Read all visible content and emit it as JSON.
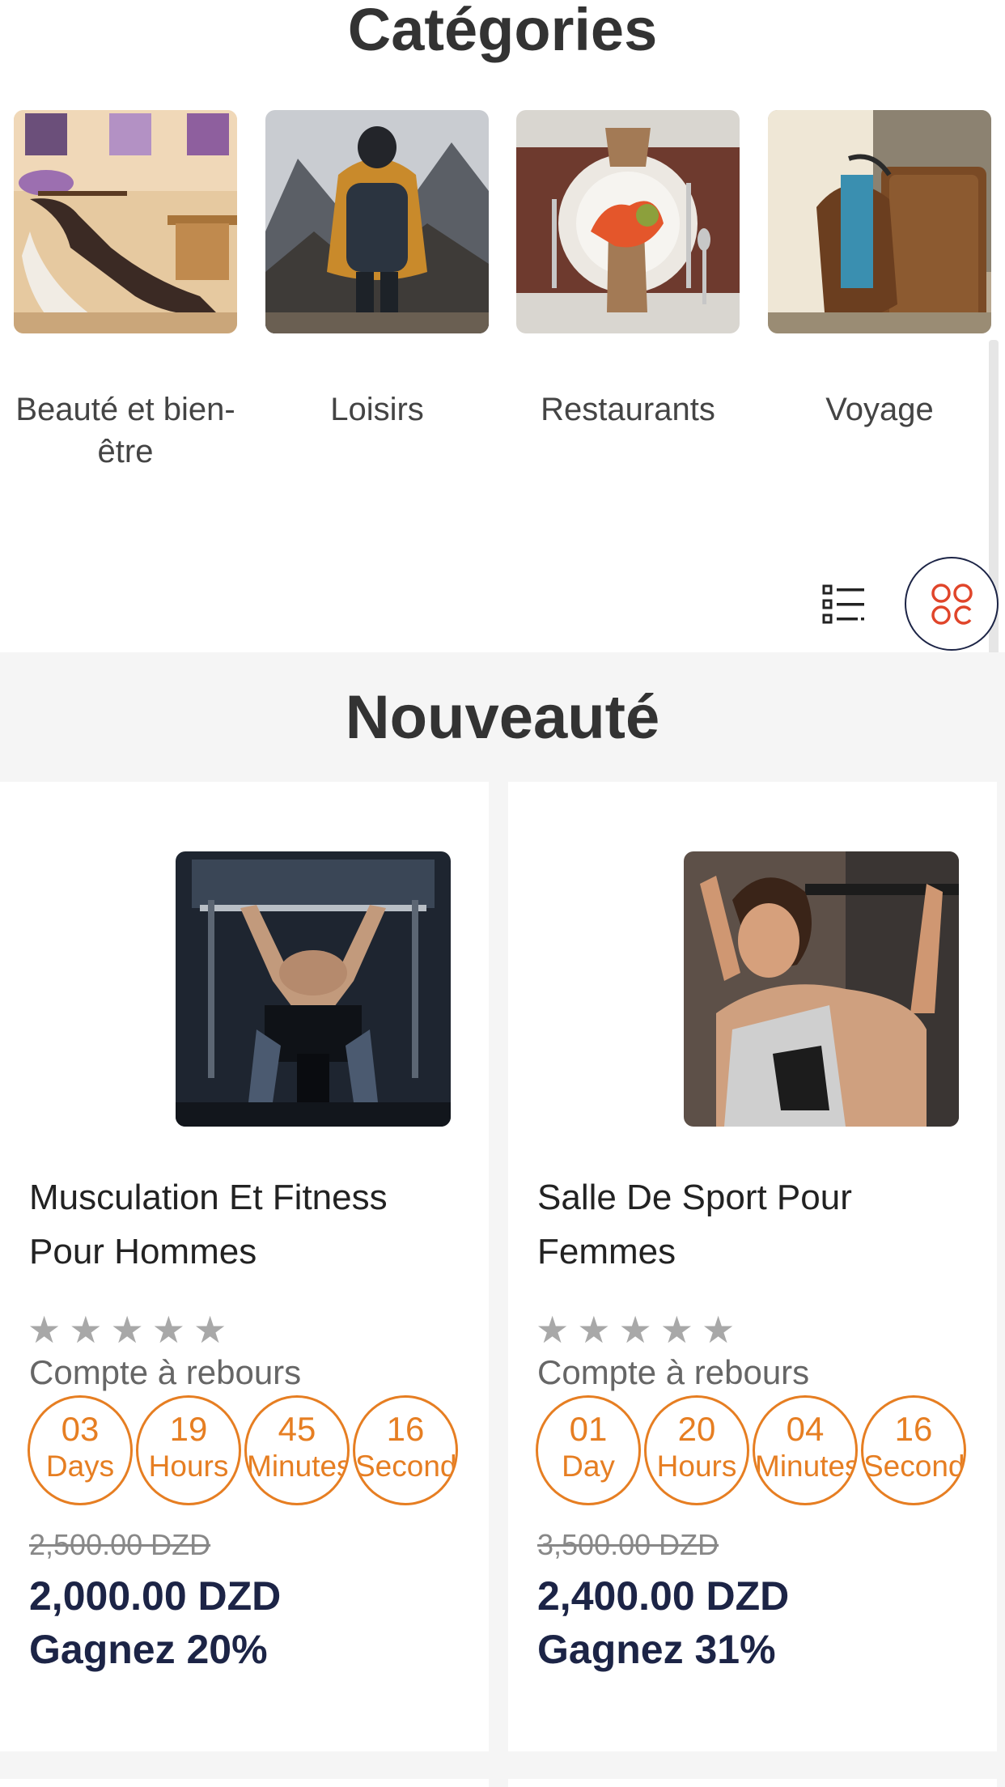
{
  "categories": {
    "title": "Catégories",
    "items": [
      {
        "label": "Beauté et bien-être"
      },
      {
        "label": "Loisirs"
      },
      {
        "label": "Restaurants"
      },
      {
        "label": "Voyage"
      }
    ]
  },
  "view_toggle": {
    "list_icon": "list-icon",
    "grid_icon": "grid-icon",
    "active": "grid",
    "colors": {
      "grid_active": "#e0452a",
      "ring": "#1c2446"
    }
  },
  "new_section": {
    "title": "Nouveauté",
    "products": [
      {
        "name": "Musculation Et Fitness Pour Hommes",
        "stars": "★★★★★",
        "rating": 0,
        "countdown_label": "Compte à rebours",
        "timer": [
          {
            "value": "03",
            "unit": "Days"
          },
          {
            "value": "19",
            "unit": "Hours"
          },
          {
            "value": "45",
            "unit": "Minutes"
          },
          {
            "value": "16",
            "unit": "Seconds"
          }
        ],
        "old_price": "2,500.00 DZD",
        "price": "2,000.00 DZD",
        "discount": "Gagnez 20%"
      },
      {
        "name": "Salle De Sport Pour Femmes",
        "stars": "★★★★★",
        "rating": 0,
        "countdown_label": "Compte à rebours",
        "timer": [
          {
            "value": "01",
            "unit": "Day"
          },
          {
            "value": "20",
            "unit": "Hours"
          },
          {
            "value": "04",
            "unit": "Minutes"
          },
          {
            "value": "16",
            "unit": "Seconds"
          }
        ],
        "old_price": "3,500.00 DZD",
        "price": "2,400.00 DZD",
        "discount": "Gagnez 31%"
      }
    ]
  },
  "colors": {
    "accent": "#e67e22",
    "price": "#1c2446",
    "stars": "#a8a8a8",
    "section_bg": "#f5f5f5"
  }
}
